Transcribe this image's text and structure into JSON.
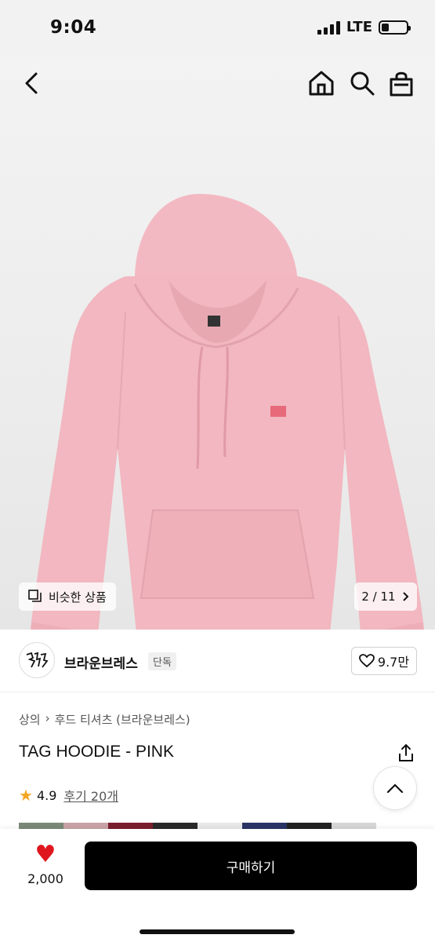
{
  "status": {
    "time": "9:04",
    "network": "LTE"
  },
  "icons": {
    "back": "chevron-left-icon",
    "home": "home-icon",
    "search": "search-icon",
    "bag": "shopping-bag-icon",
    "share": "share-icon",
    "scroll_top": "chevron-up-icon",
    "similar": "similar-items-icon"
  },
  "gallery": {
    "similar_label": "비슷한 상품",
    "page_indicator": "2 / 11"
  },
  "brand": {
    "name": "브라운브레스",
    "badge": "단독",
    "likes": "9.7만"
  },
  "breadcrumb": {
    "category": "상의",
    "subcategory": "후드 티셔츠 (브라운브레스)"
  },
  "product": {
    "title": "TAG HOODIE - PINK",
    "rating": "4.9",
    "reviews": "후기 20개"
  },
  "color_swatches": [
    "#7a8a78",
    "#c9a3a6",
    "#7a1f2e",
    "#2a2a2a",
    "#e9e9e9",
    "#2a3566",
    "#222222",
    "#d6d6d6"
  ],
  "bottom": {
    "wish_count": "2,000",
    "buy_label": "구매하기"
  },
  "colors": {
    "product_pink": "#f2b8c1",
    "heart": "#e0161e",
    "buy_button": "#000000"
  }
}
